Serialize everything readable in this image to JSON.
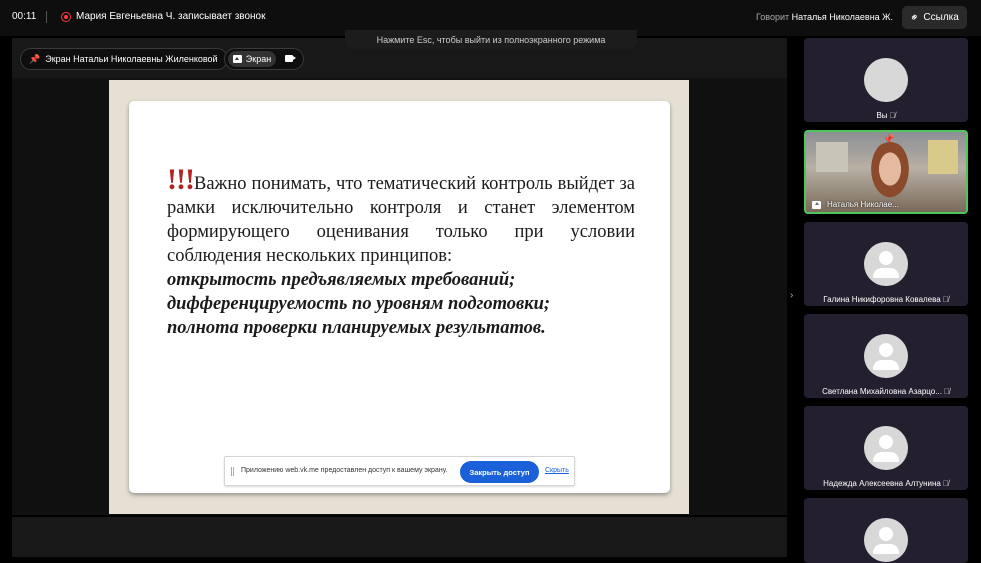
{
  "topbar": {
    "timer": "00:11",
    "recording_text": "Мария Евгеньевна Ч. записывает звонок",
    "speaking_label": "Говорит",
    "speaking_name": "Наталья Николаевна Ж.",
    "link_button": "Ссылка"
  },
  "stage": {
    "esc_hint": "Нажмите Esc, чтобы выйти из полноэкранного режима",
    "pinned_screen_label": "Экран Натальи Николаевны Жиленковой",
    "screen_toggle_label": "Экран"
  },
  "slide": {
    "exclamation": "!!!",
    "paragraph": "Важно понимать, что тематический контроль выйдет за рамки исключительно контроля и станет элементом формирующего оценивания только при условии соблюдения нескольких принципов:",
    "principle_1": "открытость предъявляемых требований;",
    "principle_2": "дифференцируемость по уровням подготовки;",
    "principle_3": "полнота проверки планируемых результатов."
  },
  "share_bar": {
    "text": "Приложению web.vk.me предоставлен доступ к вашему экрану.",
    "stop_button": "Закрыть доступ",
    "hide_link": "Скрыть"
  },
  "participants": [
    {
      "name": "Вы",
      "muted": true,
      "avatar": "photo"
    },
    {
      "name": "Наталья Николае...",
      "muted": false,
      "avatar": "video",
      "pinned": true,
      "sharing": true
    },
    {
      "name": "Галина Никифоровна Ковалева",
      "muted": true,
      "avatar": "generic"
    },
    {
      "name": "Светлана Михайловна Азарцо...",
      "muted": true,
      "avatar": "generic"
    },
    {
      "name": "Надежда Алексеевна Алтунина",
      "muted": true,
      "avatar": "generic"
    },
    {
      "name": "",
      "muted": false,
      "avatar": "generic"
    }
  ],
  "colors": {
    "accent": "#1a60d8",
    "recording": "#ff3b3b",
    "active_speaker": "#4fc65b",
    "tile_bg": "#231f2e",
    "exclamation": "#b02424"
  }
}
